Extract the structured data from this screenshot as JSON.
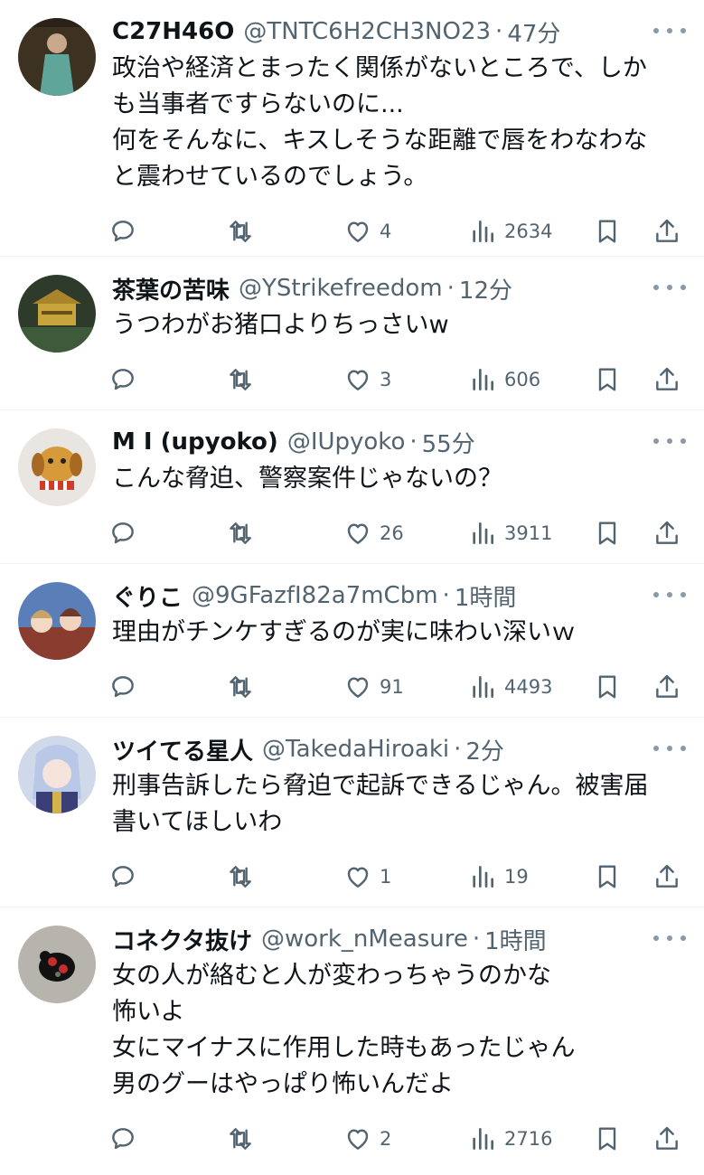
{
  "replies": [
    {
      "name": "C27H46O",
      "handle": "@TNTC6H2CH3NO23",
      "sep": "·",
      "time": "47分",
      "text": "政治や経済とまったく関係がないところで、しか\nも当事者ですらないのに...\n何をそんなに、キスしそうな距離で唇をわなわな\nと震わせているのでしょう。",
      "likes": "4",
      "views": "2634"
    },
    {
      "name": "茶葉の苦味",
      "handle": "@YStrikefreedom",
      "sep": "·",
      "time": "12分",
      "text": "うつわがお猪口よりちっさいw",
      "likes": "3",
      "views": "606"
    },
    {
      "name": "M I (upyoko)",
      "handle": "@IUpyoko",
      "sep": "·",
      "time": "55分",
      "text": "こんな脅迫、警察案件じゃないの？",
      "likes": "26",
      "views": "3911"
    },
    {
      "name": "ぐりこ",
      "handle": "@9GFazfI82a7mCbm",
      "sep": "·",
      "time": "1時間",
      "text": "理由がチンケすぎるのが実に味わい深いｗ",
      "likes": "91",
      "views": "4493"
    },
    {
      "name": "ツイてる星人",
      "handle": "@TakedaHiroaki",
      "sep": "·",
      "time": "2分",
      "text": "刑事告訴したら脅迫で起訴できるじゃん。被害届\n書いてほしいわ",
      "likes": "1",
      "views": "19"
    },
    {
      "name": "コネクタ抜け",
      "handle": "@work_nMeasure",
      "sep": "·",
      "time": "1時間",
      "text": "女の人が絡むと人が変わっちゃうのかな\n怖いよ\n女にマイナスに作用した時もあったじゃん\n男のグーはやっぱり怖いんだよ",
      "likes": "2",
      "views": "2716"
    }
  ],
  "icons": {
    "reply": "reply-icon",
    "retweet": "retweet-icon",
    "like": "heart-icon",
    "views": "views-icon",
    "bookmark": "bookmark-icon",
    "share": "share-icon",
    "more": "more-icon"
  },
  "colors": {
    "text": "#0f1419",
    "secondary": "#536471",
    "divider": "#eff3f4"
  }
}
